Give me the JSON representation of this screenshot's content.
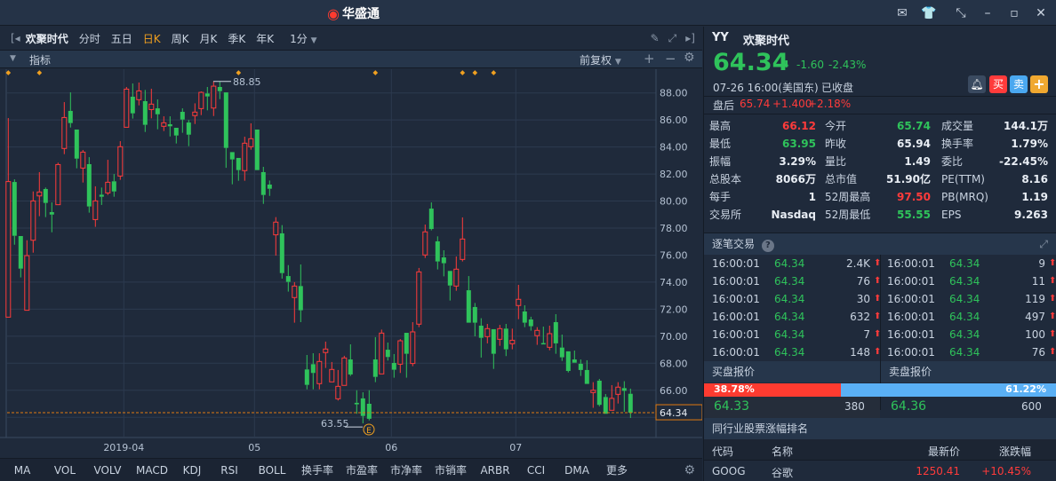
{
  "app": {
    "title": "华盛通",
    "icons": [
      "mail-icon",
      "shirt-icon",
      "shrink-icon",
      "minimize-icon",
      "maximize-icon",
      "close-icon"
    ]
  },
  "toolbar": {
    "stock_name": "欢聚时代",
    "periods": [
      "分时",
      "五日",
      "日K",
      "周K",
      "月K",
      "季K",
      "年K"
    ],
    "active_period": "日K",
    "minute": "1分"
  },
  "subbar": {
    "indicator": "指标",
    "adjust": "前复权"
  },
  "bottom_tabs": [
    "MA",
    "VOL",
    "VOLV",
    "MACD",
    "KDJ",
    "RSI",
    "BOLL",
    "换手率",
    "市盈率",
    "市净率",
    "市销率",
    "ARBR",
    "CCI",
    "DMA",
    "更多"
  ],
  "quote": {
    "symbol": "YY",
    "name": "欢聚时代",
    "price": "64.34",
    "change": "-1.60",
    "change_pct": "-2.43%",
    "time": "07-26  16:00(美国东)",
    "status": "已收盘",
    "after_label": "盘后",
    "after_price": "65.74",
    "after_change": "+1.400",
    "after_pct": "+2.18%",
    "buttons": {
      "alert": "",
      "buy": "买",
      "sell": "卖",
      "add": "+"
    },
    "stats": [
      [
        {
          "label": "最高",
          "value": "66.12",
          "color": "red"
        },
        {
          "label": "今开",
          "value": "65.74",
          "color": "green"
        },
        {
          "label": "成交量",
          "value": "144.1万",
          "color": "white"
        }
      ],
      [
        {
          "label": "最低",
          "value": "63.95",
          "color": "green"
        },
        {
          "label": "昨收",
          "value": "65.94",
          "color": "white"
        },
        {
          "label": "换手率",
          "value": "1.79%",
          "color": "white"
        }
      ],
      [
        {
          "label": "振幅",
          "value": "3.29%",
          "color": "white"
        },
        {
          "label": "量比",
          "value": "1.49",
          "color": "white"
        },
        {
          "label": "委比",
          "value": "-22.45%",
          "color": "white"
        }
      ],
      [
        {
          "label": "总股本",
          "value": "8066万",
          "color": "white"
        },
        {
          "label": "总市值",
          "value": "51.90亿",
          "color": "white"
        },
        {
          "label": "PE(TTM)",
          "value": "8.16",
          "color": "white"
        }
      ],
      [
        {
          "label": "每手",
          "value": "1",
          "color": "white"
        },
        {
          "label": "52周最高",
          "value": "97.50",
          "color": "red"
        },
        {
          "label": "PB(MRQ)",
          "value": "1.19",
          "color": "white"
        }
      ],
      [
        {
          "label": "交易所",
          "value": "Nasdaq",
          "color": "white"
        },
        {
          "label": "52周最低",
          "value": "55.55",
          "color": "green"
        },
        {
          "label": "EPS",
          "value": "9.263",
          "color": "white"
        }
      ]
    ]
  },
  "ticks": {
    "title": "逐笔交易",
    "left": [
      [
        "16:00:01",
        "64.34",
        "2.4K"
      ],
      [
        "16:00:01",
        "64.34",
        "76"
      ],
      [
        "16:00:01",
        "64.34",
        "30"
      ],
      [
        "16:00:01",
        "64.34",
        "632"
      ],
      [
        "16:00:01",
        "64.34",
        "7"
      ],
      [
        "16:00:01",
        "64.34",
        "148"
      ]
    ],
    "right": [
      [
        "16:00:01",
        "64.34",
        "9"
      ],
      [
        "16:00:01",
        "64.34",
        "11"
      ],
      [
        "16:00:01",
        "64.34",
        "119"
      ],
      [
        "16:00:01",
        "64.34",
        "497"
      ],
      [
        "16:00:01",
        "64.34",
        "100"
      ],
      [
        "16:00:01",
        "64.34",
        "76"
      ]
    ]
  },
  "orderbook": {
    "bid_title": "买盘报价",
    "ask_title": "卖盘报价",
    "bid_pct": "38.78%",
    "ask_pct": "61.22%",
    "bid_ratio": 0.3878,
    "bid_price": "64.33",
    "bid_size": "380",
    "ask_price": "64.36",
    "ask_size": "600"
  },
  "peers": {
    "title": "同行业股票涨幅排名",
    "headers": [
      "代码",
      "名称",
      "最新价",
      "涨跌幅"
    ],
    "rows": [
      [
        "GOOG",
        "谷歌",
        "1250.41",
        "+10.45%"
      ]
    ]
  },
  "colors": {
    "up": "#ff3b3b",
    "down": "#2fc35b",
    "bg": "#1f2a3b",
    "grid": "#2c3a4f",
    "accent": "#f0a020"
  },
  "chart_data": {
    "type": "candlestick",
    "y_ticks": [
      "88.00",
      "86.00",
      "84.00",
      "82.00",
      "80.00",
      "78.00",
      "76.00",
      "74.00",
      "72.00",
      "70.00",
      "68.00",
      "66.00"
    ],
    "ylim": [
      63,
      89.5
    ],
    "x_labels": [
      {
        "label": "2019-04",
        "index": 19
      },
      {
        "label": "05",
        "index": 40
      },
      {
        "label": "06",
        "index": 62
      },
      {
        "label": "07",
        "index": 82
      }
    ],
    "high_label": "88.85",
    "low_label": "63.55",
    "last_price": "64.34",
    "earnings_marker": "E",
    "ohlc": [
      [
        71.41,
        86.14,
        71.41,
        81.44
      ],
      [
        81.41,
        81.61,
        76.77,
        77.43
      ],
      [
        77.41,
        77.41,
        74.35,
        75.0
      ],
      [
        71.92,
        77.1,
        71.92,
        75.96
      ],
      [
        77.1,
        80.71,
        76.18,
        80.01
      ],
      [
        80.38,
        82.14,
        78.88,
        80.67
      ],
      [
        80.89,
        81.0,
        78.81,
        79.86
      ],
      [
        79.18,
        79.9,
        77.69,
        79.0
      ],
      [
        79.73,
        82.84,
        79.73,
        82.7
      ],
      [
        83.89,
        87.32,
        83.47,
        86.18
      ],
      [
        86.67,
        88.04,
        85.44,
        85.77
      ],
      [
        85.29,
        85.29,
        82.42,
        83.14
      ],
      [
        82.44,
        83.78,
        81.37,
        83.62
      ],
      [
        82.73,
        83.25,
        79.14,
        79.6
      ],
      [
        78.63,
        81.09,
        78.09,
        80.01
      ],
      [
        80.47,
        81.0,
        79.71,
        80.32
      ],
      [
        80.6,
        83.05,
        80.45,
        81.39
      ],
      [
        81.46,
        82.0,
        80.32,
        80.71
      ],
      [
        81.85,
        84.43,
        81.57,
        84.02
      ],
      [
        85.46,
        88.44,
        85.46,
        88.28
      ],
      [
        87.72,
        88.7,
        86.1,
        86.49
      ],
      [
        87.5,
        88.77,
        87.08,
        88.15
      ],
      [
        87.39,
        88.22,
        85.11,
        85.64
      ],
      [
        86.77,
        88.31,
        86.12,
        87.17
      ],
      [
        86.86,
        87.52,
        85.31,
        86.42
      ],
      [
        85.53,
        86.27,
        85.18,
        85.79
      ],
      [
        85.68,
        86.27,
        84.78,
        85.53
      ],
      [
        85.42,
        85.42,
        84.26,
        84.85
      ],
      [
        86.6,
        86.86,
        85.05,
        86.03
      ],
      [
        85.81,
        86.0,
        84.06,
        84.91
      ],
      [
        86.32,
        87.23,
        85.7,
        86.58
      ],
      [
        86.84,
        88.11,
        86.36,
        88.04
      ],
      [
        87.96,
        88.44,
        86.71,
        87.74
      ],
      [
        86.88,
        88.85,
        86.29,
        88.5
      ],
      [
        88.44,
        88.83,
        87.54,
        88.13
      ],
      [
        88.04,
        88.04,
        82.46,
        83.93
      ],
      [
        83.62,
        83.62,
        81.24,
        83.08
      ],
      [
        83.19,
        83.19,
        81.5,
        82.29
      ],
      [
        82.25,
        84.76,
        81.5,
        84.28
      ],
      [
        84.02,
        85.75,
        83.8,
        84.61
      ],
      [
        85.29,
        85.29,
        82.29,
        82.29
      ],
      [
        82.14,
        82.53,
        79.79,
        80.45
      ],
      [
        81.22,
        81.52,
        80.38,
        80.91
      ],
      [
        77.5,
        78.81,
        75.96,
        78.44
      ],
      [
        77.61,
        78.22,
        74.26,
        74.67
      ],
      [
        74.45,
        75.26,
        73.3,
        74.02
      ],
      [
        72.86,
        74.0,
        71.0,
        73.71
      ],
      [
        73.71,
        75.31,
        71.04,
        71.92
      ],
      [
        67.54,
        68.61,
        66.07,
        66.4
      ],
      [
        67.93,
        68.74,
        66.07,
        67.28
      ],
      [
        66.49,
        68.74,
        66.07,
        68.13
      ],
      [
        68.79,
        69.6,
        67.65,
        69.05
      ],
      [
        66.62,
        68.09,
        66.62,
        67.54
      ],
      [
        65.37,
        67.5,
        65.24,
        66.29
      ],
      [
        66.36,
        68.55,
        66.36,
        68.39
      ],
      [
        68.28,
        69.4,
        67.06,
        67.17
      ],
      [
        65.07,
        66.0,
        64.26,
        64.96
      ],
      [
        65.4,
        65.85,
        63.55,
        64.1
      ],
      [
        65.0,
        66.0,
        63.77,
        63.89
      ],
      [
        68.28,
        69.93,
        66.6,
        66.99
      ],
      [
        67.21,
        70.49,
        67.21,
        70.23
      ],
      [
        69.0,
        69.53,
        68.2,
        68.46
      ],
      [
        68.02,
        68.68,
        66.93,
        67.52
      ],
      [
        67.93,
        69.79,
        67.28,
        69.66
      ],
      [
        70.25,
        70.25,
        66.93,
        68.7
      ],
      [
        67.98,
        71.04,
        67.78,
        70.32
      ],
      [
        70.89,
        75.05,
        70.67,
        74.76
      ],
      [
        76.01,
        78.26,
        75.79,
        77.72
      ],
      [
        79.44,
        79.9,
        77.83,
        77.93
      ],
      [
        77.02,
        77.39,
        74.94,
        75.53
      ],
      [
        75.83,
        76.36,
        74.43,
        75.4
      ],
      [
        74.83,
        74.83,
        72.64,
        73.75
      ],
      [
        73.71,
        75.9,
        73.36,
        74.96
      ],
      [
        75.68,
        78.79,
        75.53,
        77.19
      ],
      [
        73.4,
        74.45,
        71.0,
        71.0
      ],
      [
        72.16,
        72.46,
        69.99,
        71.0
      ],
      [
        70.78,
        71.33,
        68.42,
        69.88
      ],
      [
        69.97,
        70.91,
        69.47,
        70.56
      ],
      [
        70.52,
        70.52,
        67.58,
        68.7
      ],
      [
        69.77,
        70.84,
        69.29,
        70.56
      ],
      [
        70.56,
        70.91,
        68.53,
        69.03
      ],
      [
        69.44,
        70.56,
        69.03,
        69.7
      ],
      [
        72.27,
        73.8,
        71.26,
        72.73
      ],
      [
        71.83,
        72.29,
        70.67,
        71.0
      ],
      [
        71.24,
        71.44,
        70.41,
        70.74
      ],
      [
        70.04,
        70.67,
        69.36,
        70.43
      ],
      [
        69.49,
        70.71,
        69.4,
        69.4
      ],
      [
        69.18,
        70.78,
        68.96,
        70.19
      ],
      [
        71.04,
        71.63,
        68.7,
        69.47
      ],
      [
        69.16,
        70.12,
        68.17,
        68.44
      ],
      [
        68.88,
        68.88,
        67.32,
        67.43
      ],
      [
        68.28,
        68.94,
        68.04,
        68.04
      ],
      [
        67.96,
        68.28,
        67.06,
        67.5
      ],
      [
        67.5,
        68.22,
        66.47,
        66.47
      ],
      [
        65.83,
        66.6,
        64.7,
        66.0
      ],
      [
        66.71,
        66.84,
        64.81,
        64.92
      ],
      [
        65.5,
        65.72,
        64.26,
        64.26
      ],
      [
        64.52,
        66.38,
        64.52,
        65.4
      ],
      [
        65.7,
        66.6,
        65.02,
        66.23
      ],
      [
        66.16,
        66.67,
        64.41,
        65.96
      ],
      [
        65.74,
        66.12,
        63.95,
        64.34
      ]
    ],
    "event_markers": [
      0,
      5,
      37,
      59,
      73,
      75,
      78
    ]
  }
}
